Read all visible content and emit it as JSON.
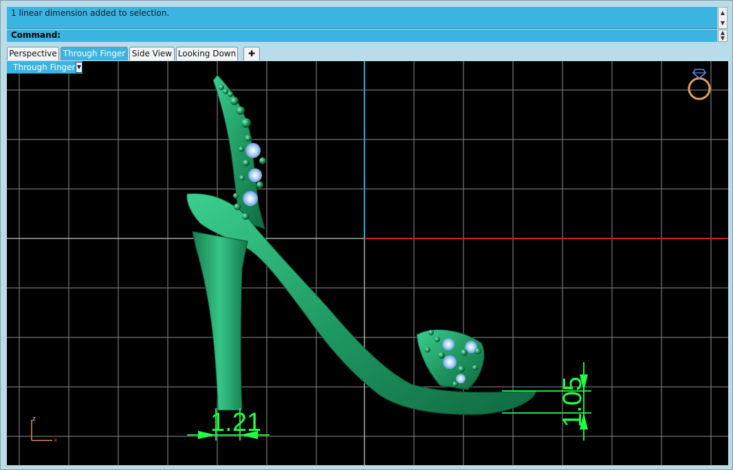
{
  "command_area": {
    "history_text": "1 linear dimension added to selection.",
    "prompt_label": "Command:"
  },
  "tabs": [
    {
      "label": "Perspective",
      "active": false
    },
    {
      "label": "Through Finger",
      "active": true
    },
    {
      "label": "Side View",
      "active": false
    },
    {
      "label": "Looking Down",
      "active": false
    }
  ],
  "add_tab_symbol": "✚",
  "viewport": {
    "label": "Through Finger",
    "dimensions": [
      {
        "value": "1.21",
        "orientation": "horizontal"
      },
      {
        "value": "1.05",
        "orientation": "vertical"
      }
    ],
    "axis": {
      "x_label": "x",
      "z_label": "z"
    },
    "colors": {
      "grid": "#8f8f8f",
      "x_axis": "#cc2222",
      "z_axis": "#2aa8c8",
      "model": "#1f9a63",
      "dimension": "#22ff44",
      "gems": "#9fc9f3",
      "widget": "#e2a05e"
    }
  }
}
